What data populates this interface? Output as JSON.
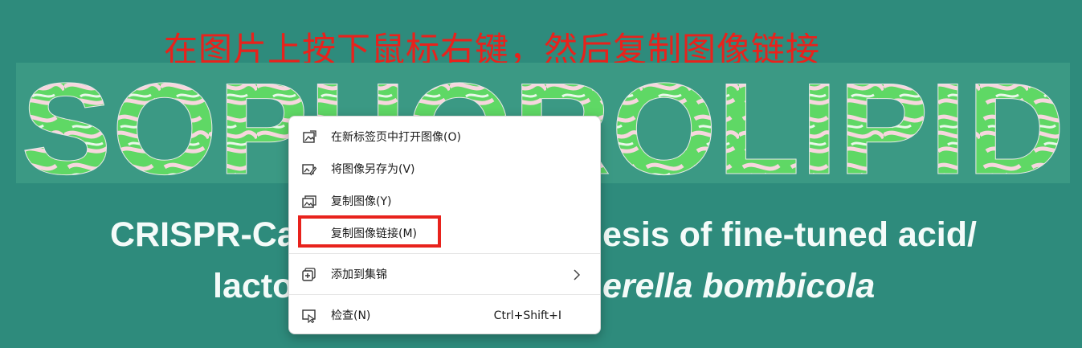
{
  "instruction": "在图片上按下鼠标右键，然后复制图像链接",
  "banner": {
    "title": "SOPHOROLIPID"
  },
  "subtitle": {
    "line1": "CRISPR-Ca",
    "line1_end": "esis of fine-tuned acid/",
    "line2": "lacto",
    "line2_end_italic": "erella bombicola"
  },
  "menu": {
    "items": [
      {
        "icon": "image-new-tab-icon",
        "label": "在新标签页中打开图像(O)"
      },
      {
        "icon": "image-save-icon",
        "label": "将图像另存为(V)"
      },
      {
        "icon": "image-copy-icon",
        "label": "复制图像(Y)"
      },
      {
        "icon": "",
        "label": "复制图像链接(M)"
      },
      {
        "icon": "collections-add-icon",
        "label": "添加到集锦",
        "submenu": true
      },
      {
        "icon": "inspect-icon",
        "label": "检查(N)",
        "shortcut": "Ctrl+Shift+I"
      }
    ]
  },
  "colors": {
    "background": "#2e8b7c",
    "accent": "#e8221c",
    "letters": "#5fd865"
  }
}
